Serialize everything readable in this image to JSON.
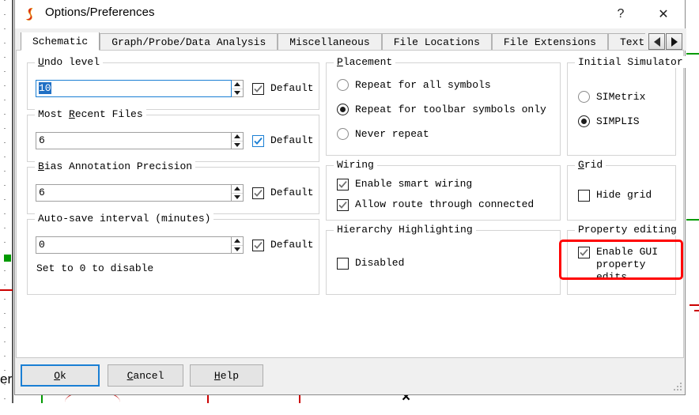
{
  "window": {
    "title": "Options/Preferences",
    "app_icon": "simetrix-s-logo-icon",
    "help_button": "?",
    "close_button": "✕"
  },
  "tabs": {
    "items": [
      {
        "label": "Schematic",
        "active": true
      },
      {
        "label": "Graph/Probe/Data Analysis",
        "active": false
      },
      {
        "label": "Miscellaneous",
        "active": false
      },
      {
        "label": "File Locations",
        "active": false
      },
      {
        "label": "File Extensions",
        "active": false
      },
      {
        "label": "Text E",
        "active": false
      }
    ],
    "scroll_prev": "◀",
    "scroll_next": "▶"
  },
  "groups": {
    "undo": {
      "legend_underlined": "U",
      "legend_rest": "ndo level",
      "value": "10",
      "selected": true,
      "default_label": "Default",
      "default_checked": true,
      "default_check_color": "#6e6e6e"
    },
    "recent": {
      "legend_pre": "Most ",
      "legend_underlined": "R",
      "legend_rest": "ecent Files",
      "value": "6",
      "default_label": "Default",
      "default_checked": true,
      "default_check_color": "#1a7fd4"
    },
    "bias": {
      "legend_underlined": "B",
      "legend_rest": "ias Annotation Precision",
      "value": "6",
      "default_label": "Default",
      "default_checked": true,
      "default_check_color": "#6e6e6e"
    },
    "autosave": {
      "legend": "Auto-save interval (minutes)",
      "value": "0",
      "default_label": "Default",
      "default_checked": true,
      "default_check_color": "#6e6e6e",
      "hint": "Set to 0 to disable"
    },
    "placement": {
      "legend_underlined": "P",
      "legend_rest": "lacement",
      "options": [
        {
          "label": "Repeat for all symbols",
          "selected": false
        },
        {
          "label": "Repeat for toolbar symbols only",
          "selected": true
        },
        {
          "label": "Never repeat",
          "selected": false
        }
      ]
    },
    "wiring": {
      "legend": "Wiring",
      "options": [
        {
          "label": "Enable smart wiring",
          "checked": true
        },
        {
          "label": "Allow route through connected",
          "checked": true
        }
      ]
    },
    "hierarchy": {
      "legend": "Hierarchy Highlighting",
      "options": [
        {
          "label": "Disabled",
          "checked": false
        }
      ]
    },
    "simulator": {
      "legend": "Initial Simulator",
      "options": [
        {
          "label": "SIMetrix",
          "selected": false
        },
        {
          "label": "SIMPLIS",
          "selected": true
        }
      ]
    },
    "grid": {
      "legend_underlined": "G",
      "legend_rest": "rid",
      "options": [
        {
          "label": "Hide grid",
          "checked": false
        }
      ]
    },
    "property_editing": {
      "legend": "Property editing",
      "options": [
        {
          "label": "Enable GUI\nproperty edits",
          "checked": true
        }
      ],
      "highlight_color": "#ff0000"
    }
  },
  "buttons": {
    "ok": {
      "underlined": "O",
      "rest": "k",
      "is_default": true
    },
    "cancel": {
      "underlined": "C",
      "rest": "ancel",
      "is_default": false
    },
    "help": {
      "underlined": "H",
      "rest": "elp",
      "is_default": false
    }
  },
  "colors": {
    "accent": "#1a7fd4",
    "dialog_bg": "#f0f0f0",
    "page_bg": "#ffffff",
    "annotation": "#ff0000"
  }
}
